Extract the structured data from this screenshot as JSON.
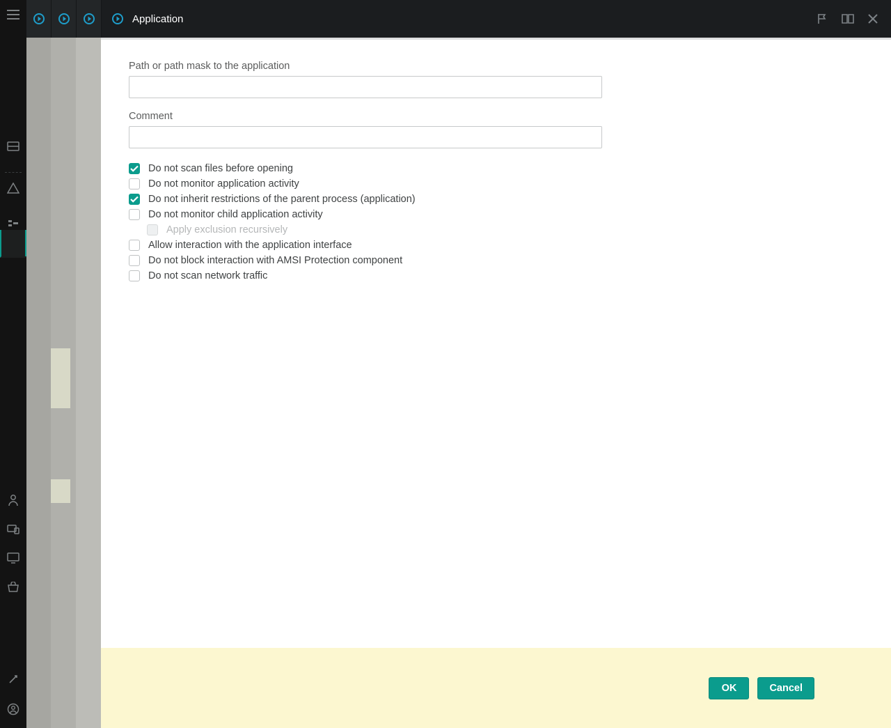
{
  "header": {
    "title": "Application"
  },
  "form": {
    "path_label": "Path or path mask to the application",
    "path_value": "",
    "comment_label": "Comment",
    "comment_value": ""
  },
  "checkboxes": [
    {
      "id": "no-scan-open",
      "label": "Do not scan files before opening",
      "checked": true,
      "disabled": false,
      "indent": false
    },
    {
      "id": "no-monitor-activity",
      "label": "Do not monitor application activity",
      "checked": false,
      "disabled": false,
      "indent": false
    },
    {
      "id": "no-inherit",
      "label": "Do not inherit restrictions of the parent process (application)",
      "checked": true,
      "disabled": false,
      "indent": false
    },
    {
      "id": "no-monitor-child",
      "label": "Do not monitor child application activity",
      "checked": false,
      "disabled": false,
      "indent": false
    },
    {
      "id": "apply-recursive",
      "label": "Apply exclusion recursively",
      "checked": false,
      "disabled": true,
      "indent": true
    },
    {
      "id": "allow-interaction",
      "label": "Allow interaction with the application interface",
      "checked": false,
      "disabled": false,
      "indent": false
    },
    {
      "id": "no-block-amsi",
      "label": "Do not block interaction with AMSI Protection component",
      "checked": false,
      "disabled": false,
      "indent": false
    },
    {
      "id": "no-scan-network",
      "label": "Do not scan network traffic",
      "checked": false,
      "disabled": false,
      "indent": false
    }
  ],
  "footer": {
    "ok": "OK",
    "cancel": "Cancel"
  }
}
